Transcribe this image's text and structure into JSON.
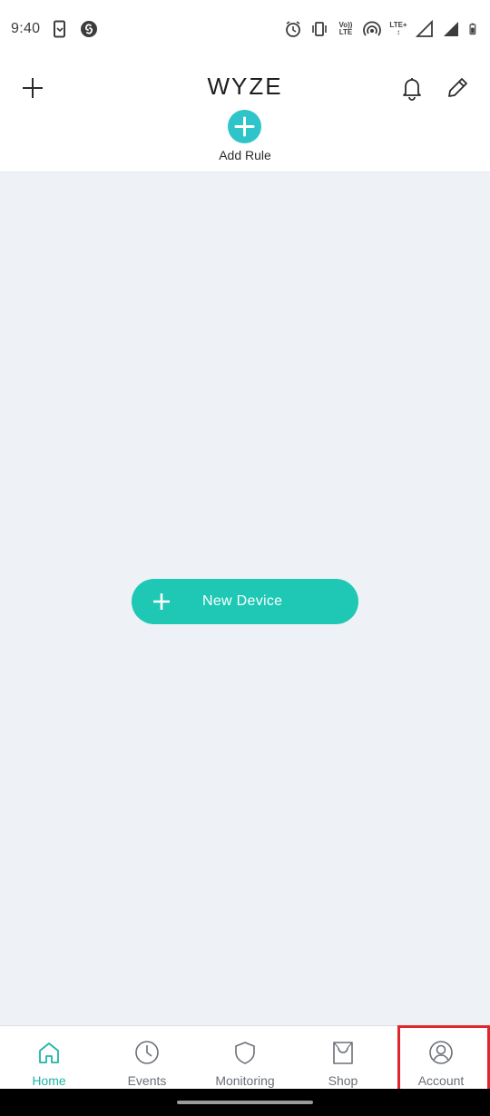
{
  "status_bar": {
    "time": "9:40",
    "volte_top": "Vo))",
    "volte_bottom": "LTE",
    "lte_label": "LTE+"
  },
  "header": {
    "logo_text": "WYZE",
    "add_rule_label": "Add Rule"
  },
  "main": {
    "new_device_label": "New Device"
  },
  "bottom_nav": {
    "items": [
      {
        "label": "Home",
        "icon": "home-icon",
        "active": true
      },
      {
        "label": "Events",
        "icon": "clock-icon",
        "active": false
      },
      {
        "label": "Monitoring",
        "icon": "shield-icon",
        "active": false
      },
      {
        "label": "Shop",
        "icon": "shopping-bag-icon",
        "active": false
      },
      {
        "label": "Account",
        "icon": "account-icon",
        "active": false
      }
    ]
  },
  "colors": {
    "accent_teal": "#2fc4c9",
    "button_green": "#1ec8b4",
    "active_nav": "#1fb5a6",
    "highlight_red": "#e0252b",
    "background": "#eef1f6"
  }
}
